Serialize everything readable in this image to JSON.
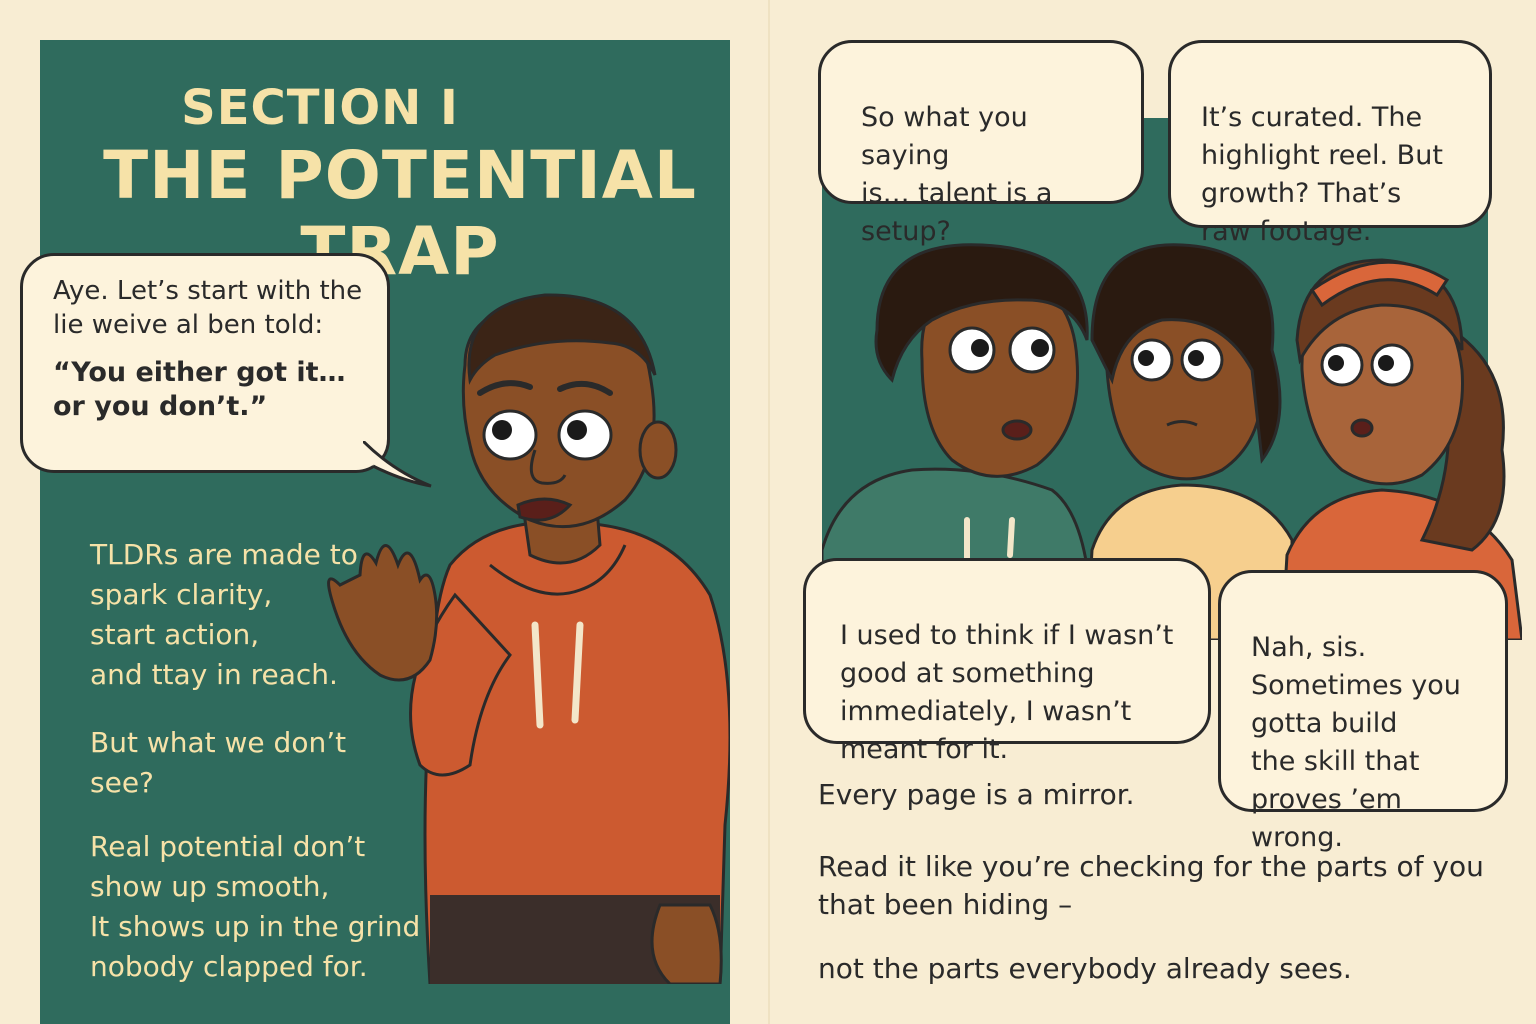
{
  "left_page": {
    "section_label": "SECTION I",
    "title": "THE POTENTIAL TRAP",
    "speech": {
      "intro": "Aye. Let’s start with the lie weive al ben told:",
      "quote": "“You either got it… or you don’t.”"
    },
    "narration": [
      "TLDRs are made to\nspark clarity,\nstart action,\nand ttay in reach.",
      "But what we don’t\nsee?",
      "Real potential don’t\nshow up smooth,\nIt shows up in the grind\nnobody clapped for."
    ]
  },
  "right_page": {
    "bubbles": [
      "So what you saying\nis… talent is a\nsetup?",
      "It’s curated. The\nhighlight reel. But\ngrowth? That’s\nraw footage.",
      "I used to think if I wasn’t\ngood at something\nimmediately, I wasn’t\nmeant for it.",
      "Nah, sis.\nSometimes you\ngotta build\nthe skill that\nproves ’em wrong."
    ],
    "narration": [
      "Every page is a mirror.",
      "Read it like you’re checking for the parts of you\nthat been hiding –",
      "not the parts everybody already sees."
    ]
  },
  "colors": {
    "page": "#f8edd3",
    "panel_teal": "#2f6b5d",
    "title_cream": "#f6e2a8",
    "hoodie_orange": "#cc5a30",
    "hoodie_green": "#3f7a68",
    "ink": "#2a2a2a"
  }
}
